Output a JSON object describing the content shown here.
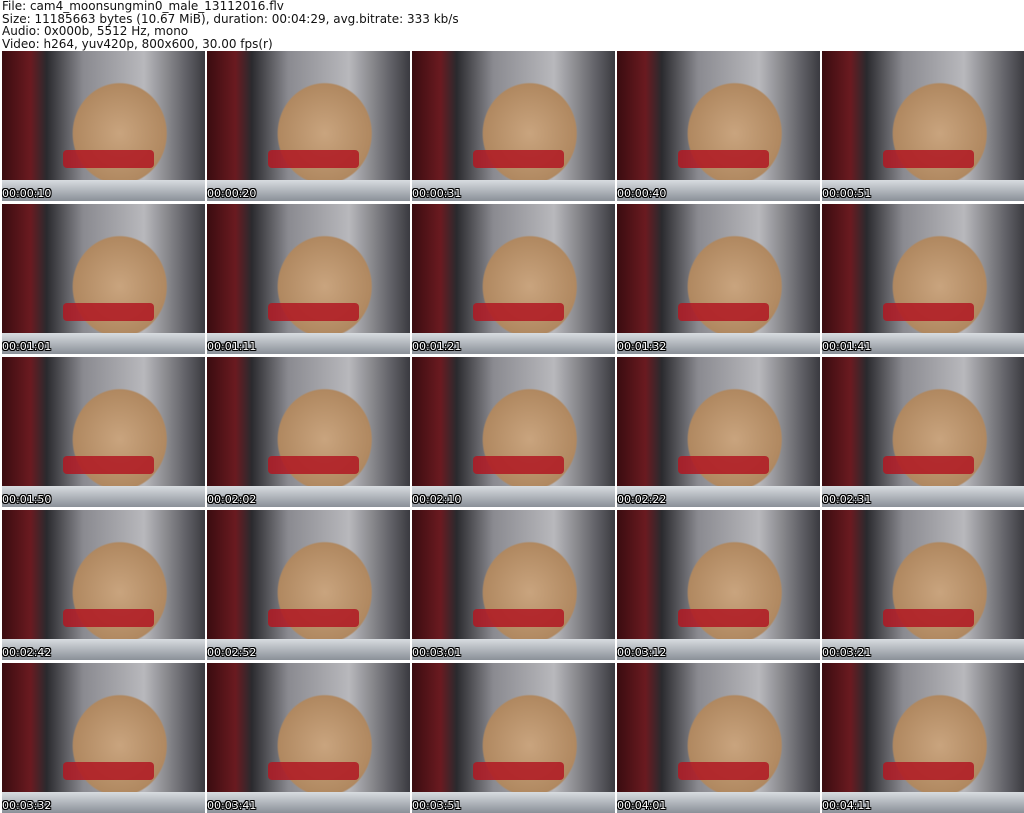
{
  "header": {
    "file": "File: cam4_moonsungmin0_male_13112016.flv",
    "size": "Size: 11185663 bytes (10.67 MiB), duration: 00:04:29, avg.bitrate: 333 kb/s",
    "audio": "Audio: 0x000b, 5512 Hz, mono",
    "video": "Video: h264, yuv420p, 800x600, 30.00 fps(r)"
  },
  "thumbnails": [
    "00:00:10",
    "00:00:20",
    "00:00:31",
    "00:00:40",
    "00:00:51",
    "00:01:01",
    "00:01:11",
    "00:01:21",
    "00:01:32",
    "00:01:41",
    "00:01:50",
    "00:02:02",
    "00:02:10",
    "00:02:22",
    "00:02:31",
    "00:02:42",
    "00:02:52",
    "00:03:01",
    "00:03:12",
    "00:03:21",
    "00:03:32",
    "00:03:41",
    "00:03:51",
    "00:04:01",
    "00:04:11"
  ]
}
